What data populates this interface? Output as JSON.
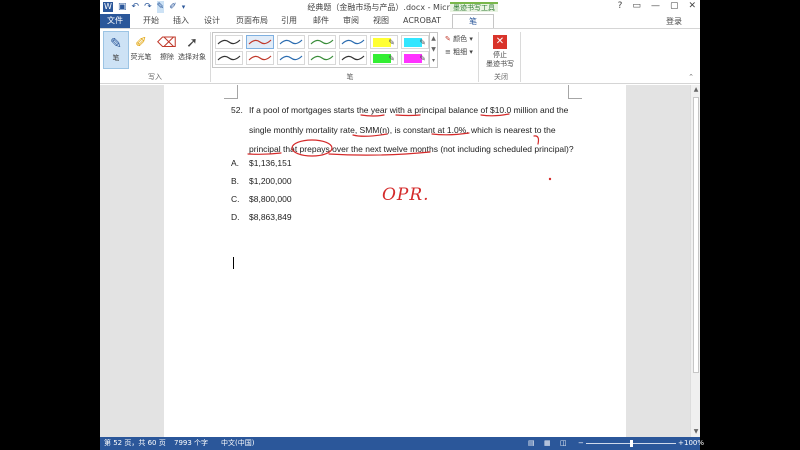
{
  "window": {
    "title": "经典题（金融市场与产品）.docx - Microsoft Word",
    "controls": [
      "?",
      "▭",
      "—",
      "▢",
      "✕"
    ]
  },
  "qat": {
    "icons": [
      "word-logo-icon",
      "save-icon",
      "undo-icon",
      "redo-icon",
      "pen-mode-icon",
      "highlighter-icon",
      "customize-icon"
    ]
  },
  "tabs": {
    "file": "文件",
    "items": [
      "开始",
      "插入",
      "设计",
      "页面布局",
      "引用",
      "邮件",
      "审阅",
      "视图",
      "ACROBAT",
      "笔"
    ],
    "contextual_group": "墨迹书写工具",
    "active": "笔",
    "signin": "登录"
  },
  "ribbon": {
    "write_group": {
      "label": "写入",
      "pen": "笔",
      "highlighter": "荧光笔",
      "eraser": "擦除",
      "select": "选择对象"
    },
    "pens_group": {
      "label": "笔",
      "color": "颜色",
      "weight": "粗细",
      "pen_colors": [
        "#333333",
        "#c0392b",
        "#2b6cb0",
        "#3a8d3a",
        "#2b6cb0",
        "#ffff33",
        "#33e6ff",
        "#333333",
        "#c0392b",
        "#2b6cb0",
        "#3a8d3a",
        "#333333",
        "#33ee33",
        "#ff33ff"
      ]
    },
    "close_group": {
      "label": "关闭",
      "stop_ink": "停止\n墨迹书写"
    }
  },
  "document": {
    "question": {
      "number": "52.",
      "lines": [
        "If a pool of mortgages starts the year with a principal balance of $10.0 million and the",
        "single monthly mortality rate, SMM(n), is constant at 1.0%, which is nearest to the",
        "principal that prepays over the next twelve months (not including scheduled principal)?"
      ]
    },
    "options": [
      {
        "key": "A.",
        "value": "$1,136,151"
      },
      {
        "key": "B.",
        "value": "$1,200,000"
      },
      {
        "key": "C.",
        "value": "$8,800,000"
      },
      {
        "key": "D.",
        "value": "$8,863,849"
      }
    ],
    "handwriting": "OPR.",
    "ink_color": "#d42a2a"
  },
  "status": {
    "page": "第 52 页，共 60 页",
    "words": "7993 个字",
    "language": "中文(中国)",
    "zoom": "100%",
    "zoom_minus": "−",
    "zoom_plus": "+"
  }
}
